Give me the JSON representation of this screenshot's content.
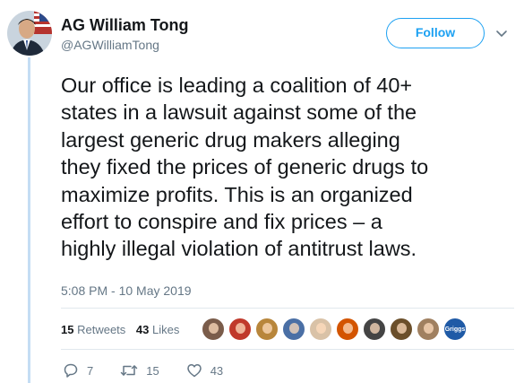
{
  "author": {
    "display_name": "AG William Tong",
    "handle": "@AGWilliamTong"
  },
  "follow_label": "Follow",
  "tweet_text": "Our office is leading a coalition of 40+\nstates in a lawsuit against some of the\nlargest generic drug makers alleging\nthey fixed the prices of generic drugs to\nmaximize profits. This is an organized\neffort to conspire and fix prices – a\nhighly illegal violation of antitrust laws.",
  "timestamp": "5:08 PM - 10 May 2019",
  "stats": {
    "retweets_count": "15",
    "retweets_label": "Retweets",
    "likes_count": "43",
    "likes_label": "Likes"
  },
  "likers": [
    {
      "icon": "avatar-face-icon",
      "color": "#7a5c4a"
    },
    {
      "icon": "avatar-colorful-icon",
      "color": "#c0392b"
    },
    {
      "icon": "avatar-face-icon",
      "color": "#b8863b"
    },
    {
      "icon": "avatar-face-icon",
      "color": "#4a6fa5"
    },
    {
      "icon": "avatar-face-icon",
      "color": "#d9c2a7"
    },
    {
      "icon": "avatar-figure-icon",
      "color": "#d35400"
    },
    {
      "icon": "avatar-pattern-icon",
      "color": "#444444"
    },
    {
      "icon": "avatar-face-icon",
      "color": "#6b4f2a"
    },
    {
      "icon": "avatar-animal-icon",
      "color": "#a08060"
    },
    {
      "icon": "avatar-logo-icon",
      "color": "#1f5aa6",
      "text": "Griggs"
    }
  ],
  "actions": {
    "reply_count": "7",
    "retweet_count": "15",
    "like_count": "43"
  },
  "colors": {
    "accent": "#1da1f2",
    "secondary_text": "#657786",
    "thread_line": "#c4ddf4"
  }
}
